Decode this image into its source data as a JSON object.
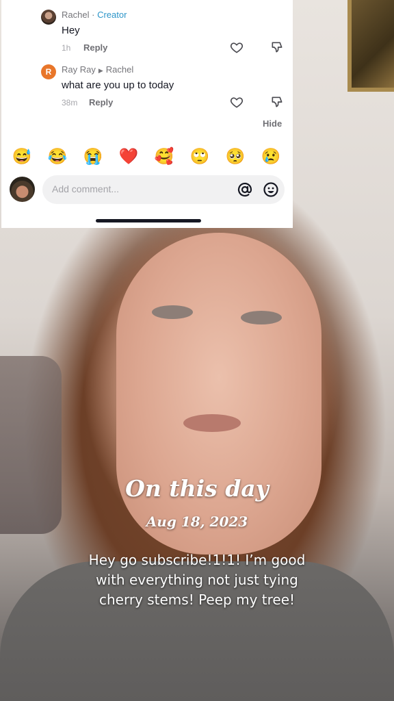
{
  "comments": [
    {
      "author": "Rachel",
      "separator": "·",
      "badge": "Creator",
      "text": "Hey",
      "time": "1h",
      "reply_label": "Reply"
    },
    {
      "author": "Ray Ray",
      "reply_to": "Rachel",
      "avatar_letter": "R",
      "text": "what are you up to today",
      "time": "38m",
      "reply_label": "Reply"
    }
  ],
  "hide_label": "Hide",
  "emojis": [
    "😅",
    "😂",
    "😭",
    "❤️",
    "🥰",
    "🙄",
    "🥺",
    "😢"
  ],
  "comment_input": {
    "placeholder": "Add comment..."
  },
  "overlay": {
    "title": "On this day",
    "date": "Aug 18, 2023",
    "caption": "Hey go subscribe!1!1! I’m good with everything not just tying cherry stems! Peep my tree!"
  },
  "colors": {
    "creator_badge": "#2c95c9",
    "ray_avatar": "#e8762a"
  }
}
